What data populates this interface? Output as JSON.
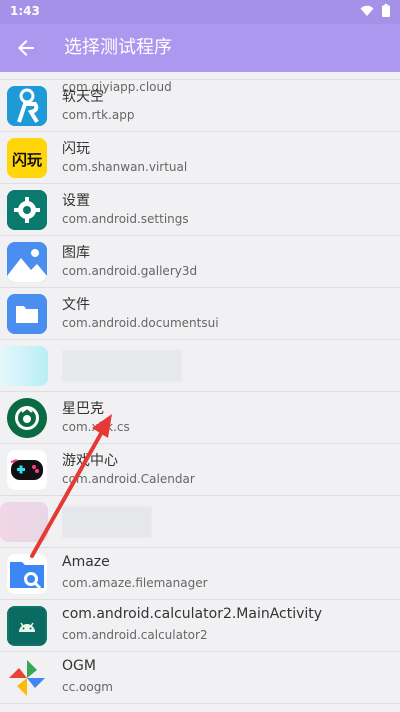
{
  "status_bar": {
    "time": "1:43"
  },
  "app_bar": {
    "title": "选择测试程序"
  },
  "list": {
    "partial_item": {
      "package": "com.qiyiapp.cloud"
    },
    "items": [
      {
        "name": "软天空",
        "package": "com.rtk.app",
        "icon": "rtk-icon"
      },
      {
        "name": "闪玩",
        "package": "com.shanwan.virtual",
        "icon": "shanwan-icon"
      },
      {
        "name": "设置",
        "package": "com.android.settings",
        "icon": "gear-icon"
      },
      {
        "name": "图库",
        "package": "com.android.gallery3d",
        "icon": "gallery-icon"
      },
      {
        "name": "文件",
        "package": "com.android.documentsui",
        "icon": "folder-icon"
      },
      {
        "name": "",
        "package": "",
        "icon": "blurred-icon"
      },
      {
        "name": "星巴克",
        "package": "com.xbk.cs",
        "icon": "starbucks-icon"
      },
      {
        "name": "游戏中心",
        "package": "com.android.Calendar",
        "icon": "gamepad-icon"
      },
      {
        "name": "",
        "package": "",
        "icon": "blurred-icon"
      },
      {
        "name": "Amaze",
        "package": "com.amaze.filemanager",
        "icon": "amaze-folder-icon"
      },
      {
        "name": "com.android.calculator2.MainActivity",
        "package": "com.android.calculator2",
        "icon": "android-icon"
      },
      {
        "name": "OGM",
        "package": "cc.oogm",
        "icon": "pinwheel-icon"
      }
    ]
  },
  "colors": {
    "app_bar": "#ad97ef",
    "status_bar": "#a691e8",
    "annotation_arrow": "#e53935"
  }
}
